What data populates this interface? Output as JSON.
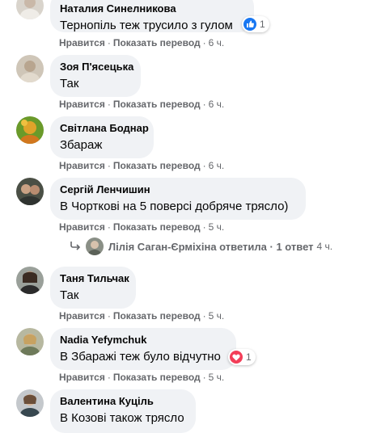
{
  "actions": {
    "like": "Нравится",
    "translate": "Показать перевод"
  },
  "comments": [
    {
      "author": "Наталия Синелникова",
      "text": "Тернопіль теж трусило з гулом",
      "time": "6 ч.",
      "reaction": {
        "type": "like",
        "count": "1",
        "color": "#1877f2"
      }
    },
    {
      "author": "Зоя П'ясецька",
      "text": "Так",
      "time": "6 ч."
    },
    {
      "author": "Світлана Боднар",
      "text": "Збараж",
      "time": "6 ч."
    },
    {
      "author": "Сергій Ленчишин",
      "text": "В Чорткові на 5 поверсі добряче трясло)",
      "time": "5 ч.",
      "reply_summary": {
        "text": "Лілія Саган-Єрміхіна ответила · 1 ответ",
        "time": "4 ч."
      }
    },
    {
      "author": "Таня Тильчак",
      "text": "Так",
      "time": "5 ч."
    },
    {
      "author": "Nadia Yefymchuk",
      "text": "В Збаражі теж було відчутно",
      "time": "5 ч.",
      "reaction": {
        "type": "love",
        "count": "1",
        "color": "#f33e58"
      }
    },
    {
      "author": "Валентина Куціль",
      "text": "В Козові також трясло"
    }
  ]
}
